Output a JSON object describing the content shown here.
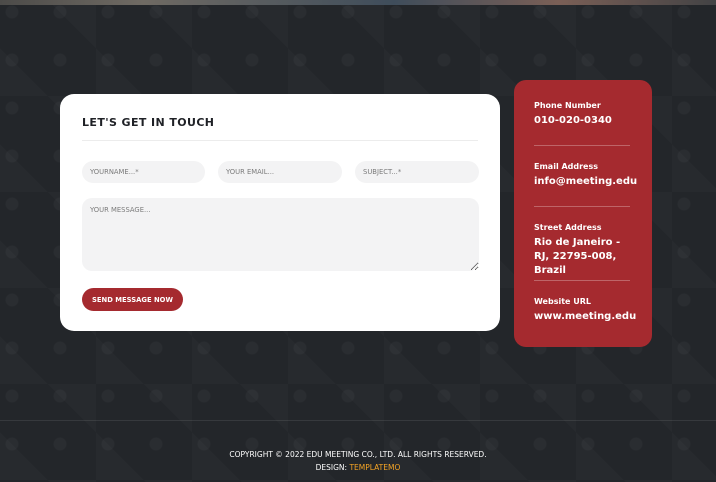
{
  "contact_form": {
    "title": "LET'S GET IN TOUCH",
    "fields": {
      "name_placeholder": "YOURNAME...*",
      "email_placeholder": "YOUR EMAIL...",
      "subject_placeholder": "SUBJECT...*",
      "message_placeholder": "YOUR MESSAGE..."
    },
    "send_button": "SEND MESSAGE NOW"
  },
  "contact_info": [
    {
      "label": "Phone Number",
      "value": "010-020-0340"
    },
    {
      "label": "Email Address",
      "value": "info@meeting.edu"
    },
    {
      "label": "Street Address",
      "value": "Rio de Janeiro - RJ, 22795-008, Brazil"
    },
    {
      "label": "Website URL",
      "value": "www.meeting.edu"
    }
  ],
  "footer": {
    "copyright": "COPYRIGHT © 2022 EDU MEETING CO., LTD. ALL RIGHTS RESERVED.",
    "design_label": "DESIGN:",
    "design_link": "TEMPLATEMO"
  },
  "colors": {
    "brand_red": "#a52a2f",
    "accent_orange": "#f5a425",
    "background_dark": "#23262a"
  }
}
